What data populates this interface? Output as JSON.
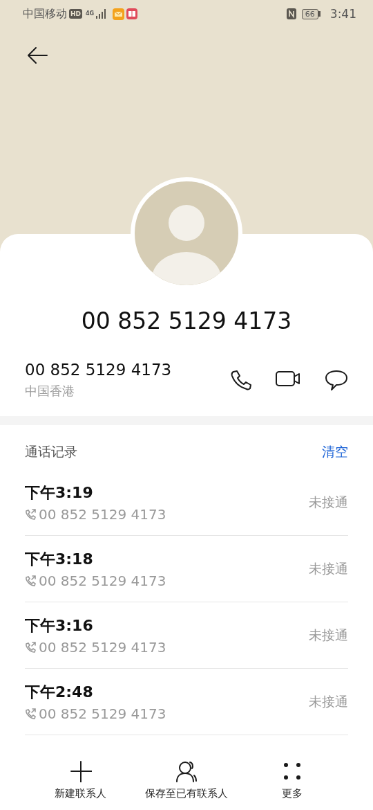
{
  "status_bar": {
    "carrier": "中国移动",
    "hd_badge": "HD",
    "network": "4G",
    "battery": "66",
    "time": "3:41"
  },
  "contact": {
    "display_name": "00 852 5129 4173"
  },
  "number_row": {
    "number": "00 852 5129 4173",
    "region": "中国香港"
  },
  "call_log": {
    "title": "通话记录",
    "clear_label": "清空",
    "calls": [
      {
        "time": "下午3:19",
        "number": "00 852 5129 4173",
        "status": "未接通"
      },
      {
        "time": "下午3:18",
        "number": "00 852 5129 4173",
        "status": "未接通"
      },
      {
        "time": "下午3:16",
        "number": "00 852 5129 4173",
        "status": "未接通"
      },
      {
        "time": "下午2:48",
        "number": "00 852 5129 4173",
        "status": "未接通"
      }
    ]
  },
  "bottom_bar": [
    {
      "kind": "add",
      "label": "新建联系人"
    },
    {
      "kind": "person",
      "label": "保存至已有联系人"
    },
    {
      "kind": "more",
      "label": "更多"
    }
  ]
}
